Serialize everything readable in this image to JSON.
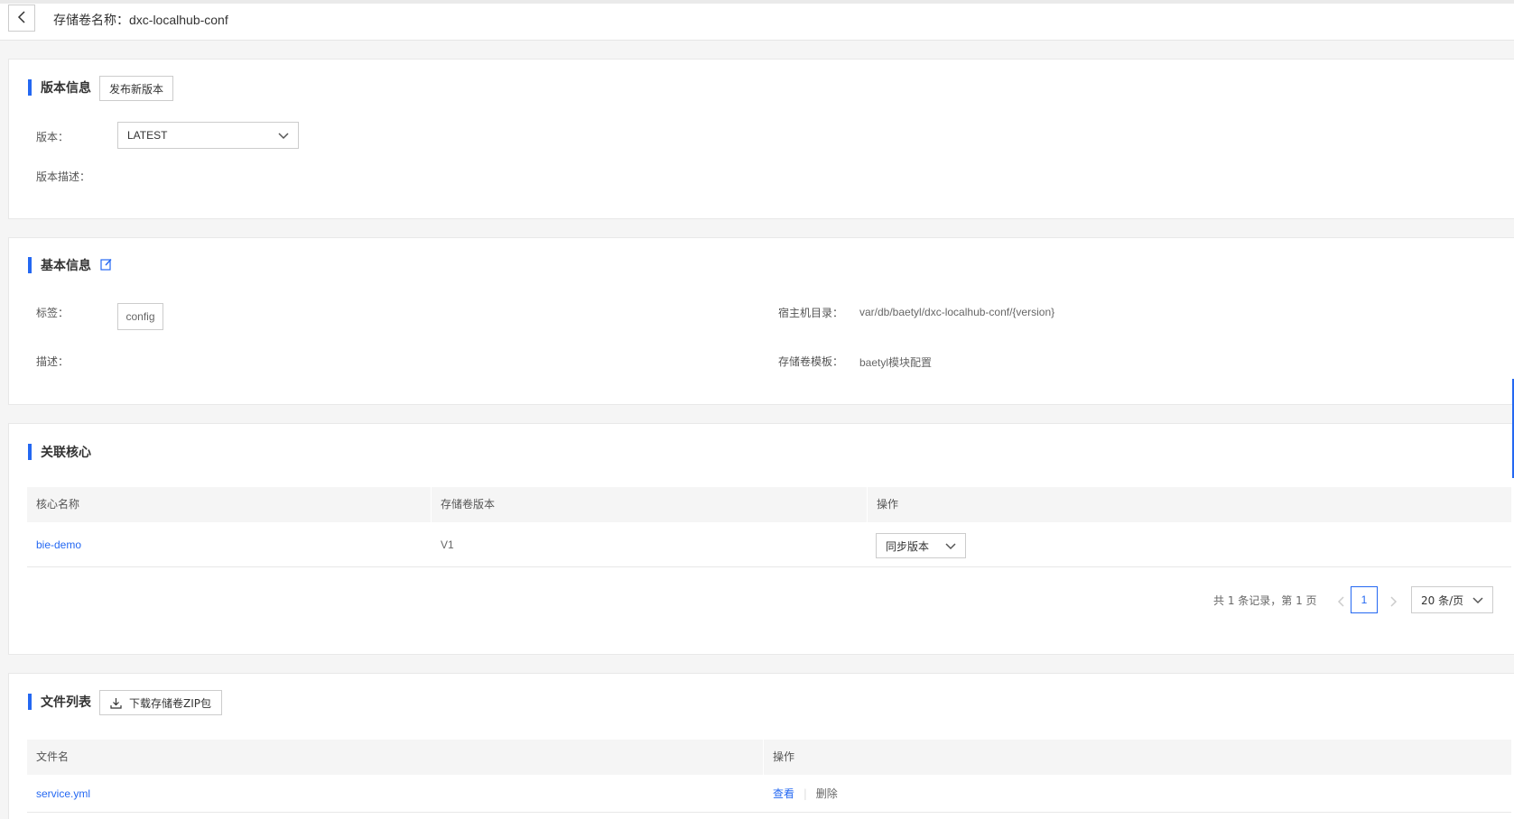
{
  "header": {
    "title_label": "存储卷名称：",
    "title_value": "dxc-localhub-conf"
  },
  "version_section": {
    "title": "版本信息",
    "publish_button": "发布新版本",
    "version_label": "版本：",
    "version_value": "LATEST",
    "description_label": "版本描述："
  },
  "basic_section": {
    "title": "基本信息",
    "tags_label": "标签：",
    "tag_value": "config",
    "description_label": "描述：",
    "host_dir_label": "宿主机目录：",
    "host_dir_value": "var/db/baetyl/dxc-localhub-conf/{version}",
    "template_label": "存储卷模板：",
    "template_value": "baetyl模块配置"
  },
  "cores_section": {
    "title": "关联核心",
    "columns": [
      "核心名称",
      "存储卷版本",
      "操作"
    ],
    "rows": [
      {
        "name": "bie-demo",
        "version": "V1",
        "action": "同步版本"
      }
    ],
    "pagination": {
      "summary": "共 1 条记录，第 1 页",
      "current_page": "1",
      "page_size": "20 条/页"
    }
  },
  "files_section": {
    "title": "文件列表",
    "download_button": "下载存储卷ZIP包",
    "columns": [
      "文件名",
      "操作"
    ],
    "rows": [
      {
        "name": "service.yml",
        "view": "查看",
        "delete": "删除"
      }
    ]
  },
  "colors": {
    "accent": "#2468f2",
    "border": "#e8e8e8",
    "header_bg": "#f5f5f5"
  }
}
